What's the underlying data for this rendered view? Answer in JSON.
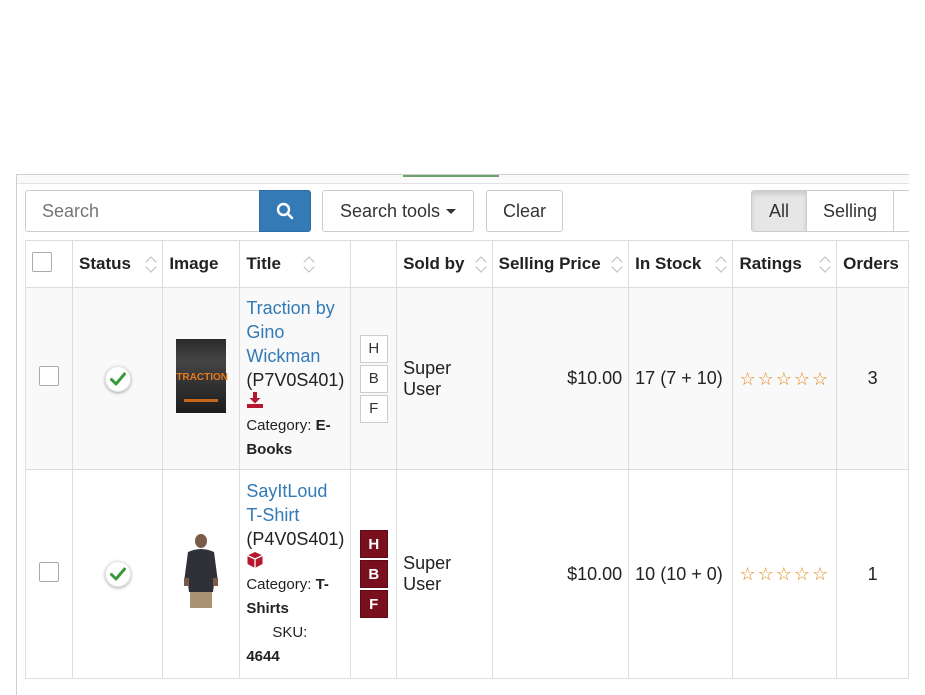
{
  "toolbar": {
    "search_placeholder": "Search",
    "search_tools_label": "Search tools",
    "clear_label": "Clear",
    "filter_all_label": "All",
    "filter_selling_label": "Selling"
  },
  "columns": {
    "status": "Status",
    "image": "Image",
    "title": "Title",
    "sold_by": "Sold by",
    "selling_price": "Selling Price",
    "in_stock": "In Stock",
    "ratings": "Ratings",
    "orders": "Orders"
  },
  "rows": [
    {
      "title": "Traction by Gino Wickman",
      "code": "(P7V0S401)",
      "type_icon": "download-icon",
      "category_label": "Category:",
      "category": "E-Books",
      "sku_label": "",
      "sku": "",
      "hbf": [
        "H",
        "B",
        "F"
      ],
      "hbf_active": false,
      "sold_by": "Super User",
      "price": "$10.00",
      "stock": "17 (7 + 10)",
      "ratings": "☆☆☆☆☆",
      "orders": "3",
      "image_text": "TRACTION",
      "colors": {
        "icon": "#b5172e"
      }
    },
    {
      "title": "SayItLoud T-Shirt",
      "code": "(P4V0S401)",
      "type_icon": "box-icon",
      "category_label": "Category:",
      "category": "T-Shirts",
      "sku_label": "SKU:",
      "sku": "4644",
      "hbf": [
        "H",
        "B",
        "F"
      ],
      "hbf_active": true,
      "sold_by": "Super User",
      "price": "$10.00",
      "stock": "10 (10 + 0)",
      "ratings": "☆☆☆☆☆",
      "orders": "1",
      "colors": {
        "icon": "#b5172e",
        "hbf_active": "#7a0f1d"
      }
    }
  ],
  "colors": {
    "primary": "#337ab7",
    "status_ok": "#3a9a3a",
    "star": "#e08a1e"
  }
}
